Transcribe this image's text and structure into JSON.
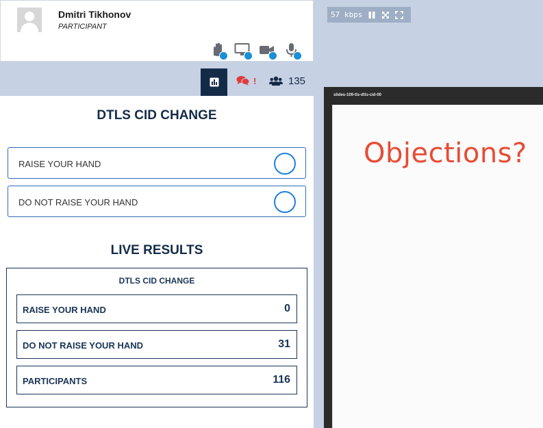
{
  "user": {
    "name": "Dmitri Tikhonov",
    "role": "PARTICIPANT",
    "actions": [
      "raise-hand-icon",
      "screen-share-icon",
      "camera-icon",
      "microphone-icon"
    ]
  },
  "tabs": {
    "poll_icon": "bar-chart-icon",
    "chat_alert": "!",
    "participants_count": "135"
  },
  "poll": {
    "title": "DTLS CID CHANGE",
    "options": [
      {
        "label": "RAISE YOUR HAND"
      },
      {
        "label": "DO NOT RAISE YOUR HAND"
      }
    ]
  },
  "live_results": {
    "heading": "LIVE RESULTS",
    "title": "DTLS CID CHANGE",
    "rows": [
      {
        "label": "RAISE YOUR HAND",
        "value": "0"
      },
      {
        "label": "DO NOT RAISE YOUR HAND",
        "value": "31"
      },
      {
        "label": "PARTICIPANTS",
        "value": "116"
      }
    ]
  },
  "video": {
    "bitrate": "57 kbps",
    "slide_name": "slides-109-tls-dtls-cid-00",
    "slide_text": "Objections?"
  },
  "colors": {
    "navy": "#142b48",
    "accent_blue": "#1d7fde",
    "alert_red": "#e03b3b",
    "slide_text": "#e94b35",
    "background": "#c6d1e3"
  }
}
